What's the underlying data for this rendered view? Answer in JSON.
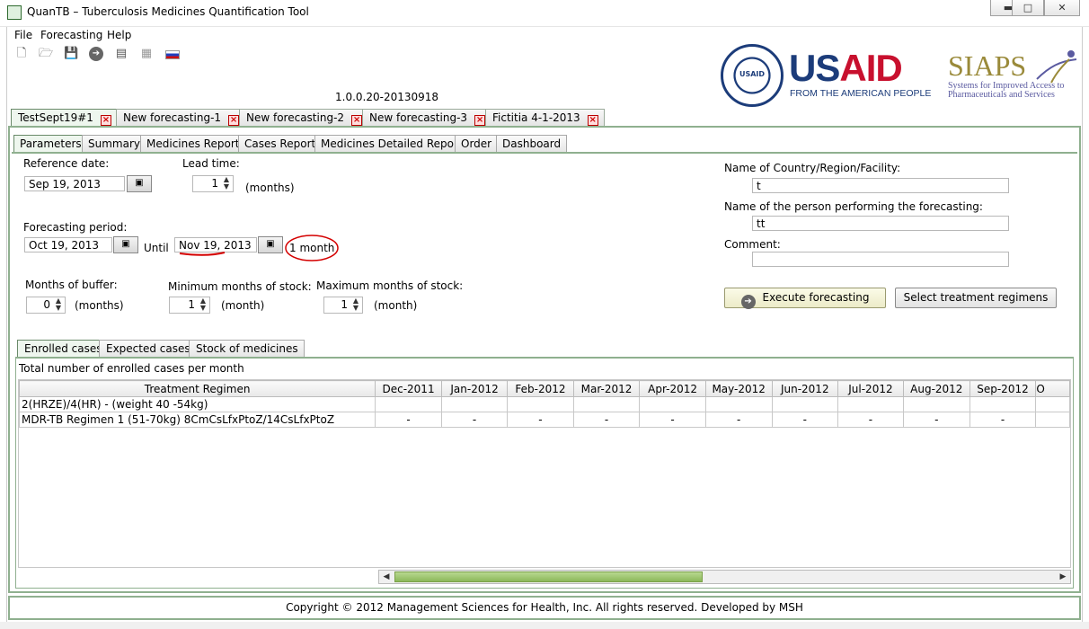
{
  "window": {
    "title": "QuanTB – Tuberculosis Medicines Quantification Tool",
    "controls": [
      "minimize",
      "maximize",
      "close"
    ]
  },
  "menu": [
    "File",
    "Forecasting",
    "Help"
  ],
  "toolbar": [
    {
      "icon": "new-file-icon",
      "glyph": "🗋"
    },
    {
      "icon": "open-folder-icon",
      "glyph": "🗁"
    },
    {
      "icon": "save-icon",
      "glyph": "💾"
    },
    {
      "icon": "go-arrow-icon",
      "glyph": "➔"
    },
    {
      "icon": "excel-export-icon",
      "glyph": "▤"
    },
    {
      "icon": "english-flag-icon",
      "glyph": "▦"
    },
    {
      "icon": "russian-flag-icon",
      "glyph": "▬"
    }
  ],
  "logos": {
    "usaid": {
      "word": "USAID",
      "tagline": "FROM THE AMERICAN PEOPLE",
      "seal_text": "USAID",
      "color_blue": "#1c3c7a",
      "color_red": "#c8102e"
    },
    "siaps": {
      "word": "SIAPS",
      "tagline": "Systems for Improved Access to Pharmaceuticals and Services"
    }
  },
  "version": "1.0.0.20-20130918",
  "doc_tabs": [
    {
      "label": "TestSept19#1",
      "active": true
    },
    {
      "label": "New forecasting-1",
      "active": false
    },
    {
      "label": "New forecasting-2",
      "active": false
    },
    {
      "label": "New forecasting-3",
      "active": false
    },
    {
      "label": "Fictitia 4-1-2013",
      "active": false
    }
  ],
  "sub_tabs": [
    {
      "label": "Parameters",
      "active": true
    },
    {
      "label": "Summary",
      "active": false
    },
    {
      "label": "Medicines Report",
      "active": false
    },
    {
      "label": "Cases Report",
      "active": false
    },
    {
      "label": "Medicines Detailed Report",
      "active": false
    },
    {
      "label": "Order",
      "active": false
    },
    {
      "label": "Dashboard",
      "active": false
    }
  ],
  "parameters": {
    "reference_date_label": "Reference date:",
    "reference_date": "Sep 19, 2013",
    "lead_time_label": "Lead time:",
    "lead_time": "1",
    "lead_time_unit": "(months)",
    "forecasting_period_label": "Forecasting period:",
    "period_start": "Oct 19, 2013",
    "until_label": "Until",
    "period_end": "Nov 19, 2013",
    "period_duration": "1 month",
    "buffer_label": "Months of buffer:",
    "buffer_value": "0",
    "buffer_unit": "(months)",
    "min_stock_label": "Minimum months of stock:",
    "min_stock_value": "1",
    "min_stock_unit": "(month)",
    "max_stock_label": "Maximum months of stock:",
    "max_stock_value": "1",
    "max_stock_unit": "(month)",
    "country_label": "Name of Country/Region/Facility:",
    "country_value": "t",
    "person_label": "Name of the person performing the forecasting:",
    "person_value": "tt",
    "comment_label": "Comment:",
    "comment_value": "",
    "execute_button": "Execute forecasting",
    "select_regimens_button": "Select treatment regimens",
    "annotation_color": "#d40000"
  },
  "case_tabs": [
    {
      "label": "Enrolled cases",
      "active": true
    },
    {
      "label": "Expected cases",
      "active": false
    },
    {
      "label": "Stock of medicines",
      "active": false
    }
  ],
  "enrolled": {
    "caption": "Total number of enrolled cases per month",
    "columns": [
      "Treatment Regimen",
      "Dec-2011",
      "Jan-2012",
      "Feb-2012",
      "Mar-2012",
      "Apr-2012",
      "May-2012",
      "Jun-2012",
      "Jul-2012",
      "Aug-2012",
      "Sep-2012",
      "O"
    ],
    "rows": [
      {
        "regimen": "2(HRZE)/4(HR) - (weight 40 -54kg)",
        "values": [
          "",
          "",
          "",
          "",
          "",
          "",
          "",
          "",
          "",
          "",
          ""
        ]
      },
      {
        "regimen": "MDR-TB Regimen 1 (51-70kg)  8CmCsLfxPtoZ/14CsLfxPtoZ",
        "values": [
          "-",
          "-",
          "-",
          "-",
          "-",
          "-",
          "-",
          "-",
          "-",
          "-",
          ""
        ]
      }
    ],
    "scroll_position": 0.0
  },
  "footer": "Copyright © 2012 Management Sciences for Health, Inc. All rights reserved. Developed by MSH"
}
